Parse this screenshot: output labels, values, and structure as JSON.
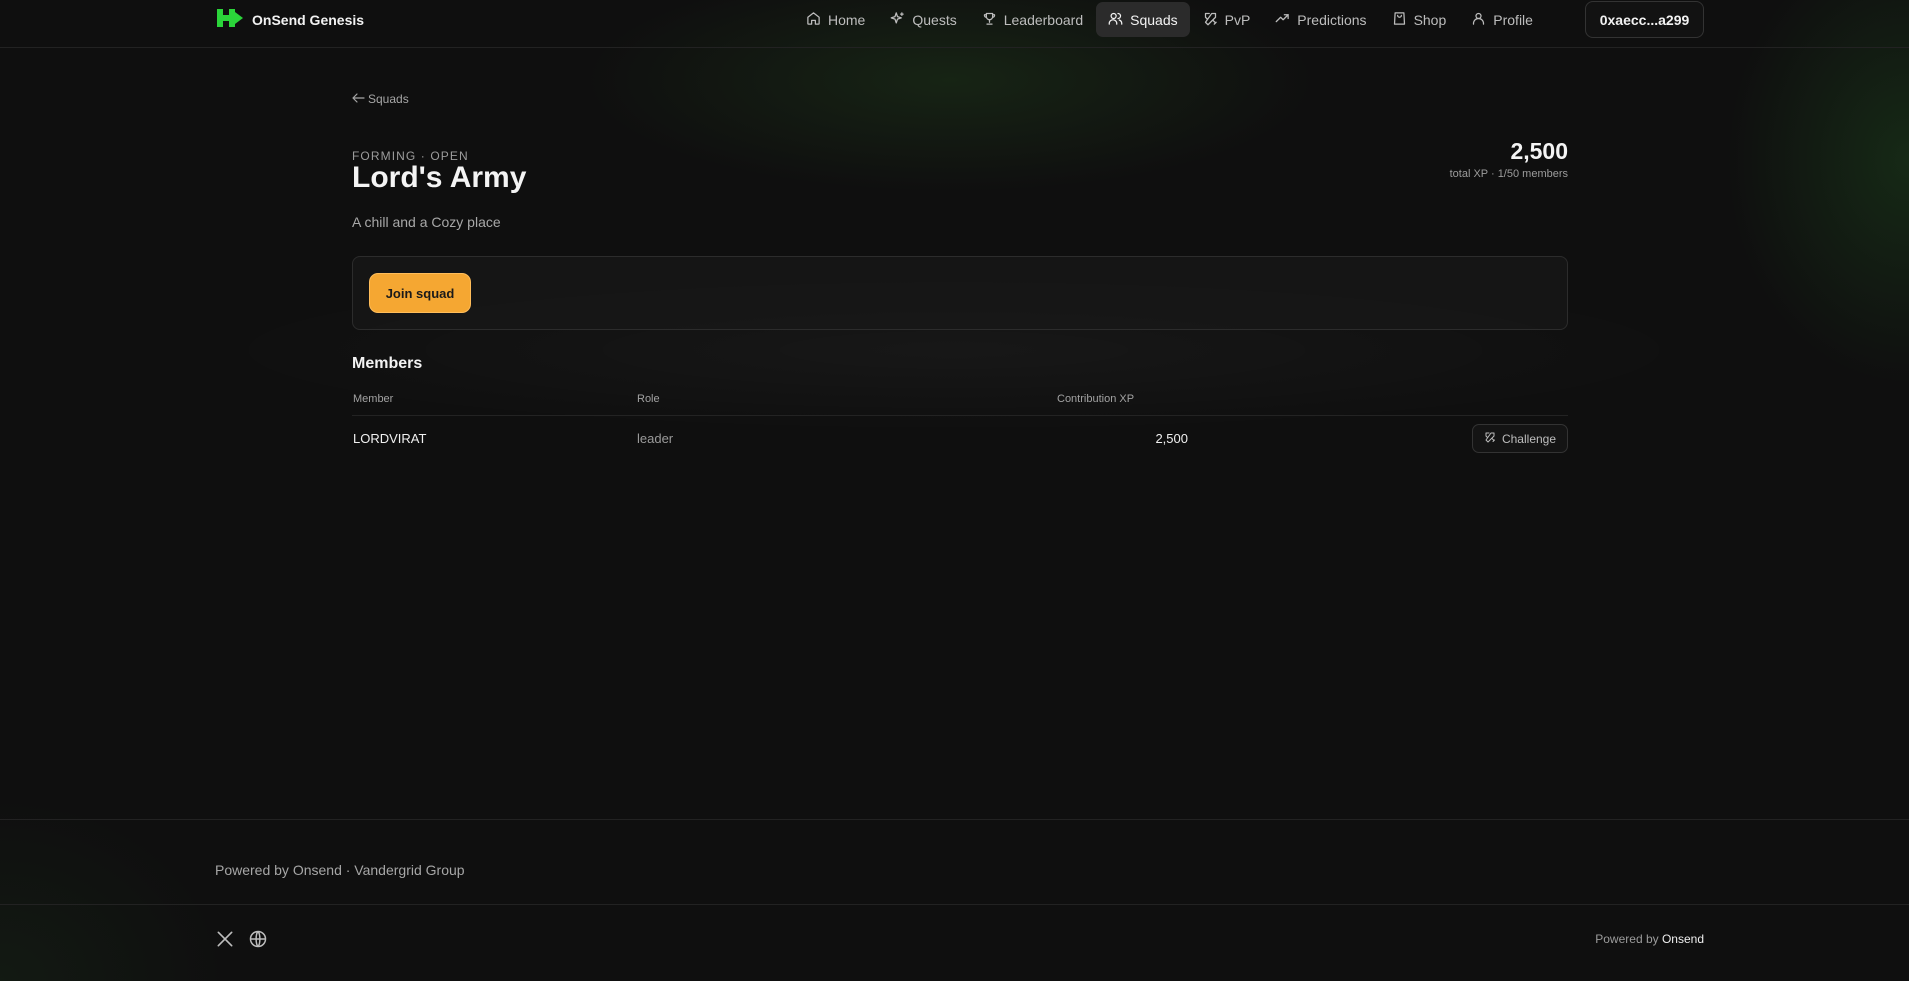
{
  "brand": {
    "name": "OnSend Genesis",
    "logo_icon": "onsend-logo-icon",
    "accent": "#2bd43a"
  },
  "nav": {
    "items": [
      {
        "label": "Home",
        "icon": "home-icon"
      },
      {
        "label": "Quests",
        "icon": "sparkles-icon"
      },
      {
        "label": "Leaderboard",
        "icon": "trophy-icon"
      },
      {
        "label": "Squads",
        "icon": "users-icon",
        "active": true
      },
      {
        "label": "PvP",
        "icon": "swords-icon"
      },
      {
        "label": "Predictions",
        "icon": "trending-up-icon"
      },
      {
        "label": "Shop",
        "icon": "shopping-bag-icon"
      },
      {
        "label": "Profile",
        "icon": "user-icon"
      }
    ],
    "wallet": "0xaecc...a299"
  },
  "page": {
    "back_label": "Squads",
    "status": "FORMING · OPEN",
    "title": "Lord's Army",
    "description": "A chill and a Cozy place",
    "total_xp": "2,500",
    "xp_meta": "total XP · 1/50 members",
    "join_label": "Join squad",
    "join_color": "#f5a732"
  },
  "members": {
    "title": "Members",
    "columns": [
      "Member",
      "Role",
      "Contribution XP"
    ],
    "rows": [
      {
        "member": "LORDVIRAT",
        "role": "leader",
        "xp": "2,500",
        "action": "Challenge"
      }
    ]
  },
  "footer": {
    "text": "Powered by Onsend · Vandergrid Group",
    "powered_prefix": "Powered by",
    "powered_brand": "Onsend",
    "social": [
      "x-icon",
      "globe-icon"
    ]
  }
}
